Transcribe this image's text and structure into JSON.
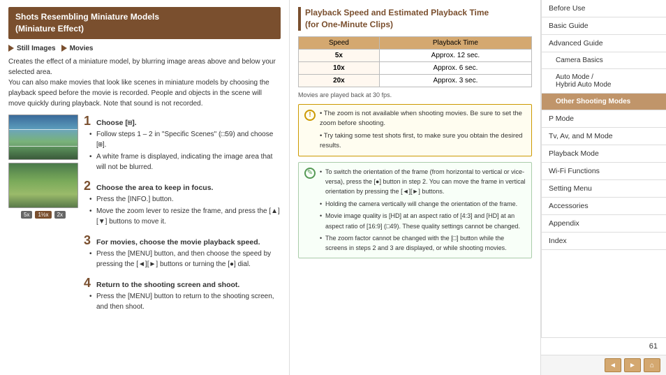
{
  "left": {
    "title": "Shots Resembling Miniature Models\n(Miniature Effect)",
    "media_labels": [
      "Still Images",
      "Movies"
    ],
    "description": [
      "Creates the effect of a miniature model, by blurring image areas above and below your selected area.",
      "You can also make movies that look like scenes in miniature models by choosing the playback speed before the movie is recorded. People and objects in the scene will move quickly during playback. Note that sound is not recorded."
    ],
    "steps": [
      {
        "number": "1",
        "title": "Choose [",
        "title_suffix": "].",
        "bullets": [
          "Follow steps 1 – 2 in \"Specific Scenes\" (□59) and choose [",
          "A white frame is displayed, indicating the image area that will not be blurred."
        ]
      },
      {
        "number": "2",
        "title": "Choose the area to keep in focus.",
        "bullets": [
          "Press the [INFO.] button.",
          "Move the zoom lever to resize the frame, and press the [▲][▼] buttons to move it."
        ]
      },
      {
        "number": "3",
        "title": "For movies, choose the movie playback speed.",
        "bullets": [
          "Press the [MENU] button, and then choose the speed by pressing the [◄][►] buttons or turning the [●] dial."
        ]
      },
      {
        "number": "4",
        "title": "Return to the shooting screen and shoot.",
        "bullets": [
          "Press the [MENU] button to return to the shooting screen, and then shoot."
        ]
      }
    ],
    "speed_buttons": [
      "5x",
      "1½x",
      "2x"
    ]
  },
  "center": {
    "title": "Playback Speed and Estimated Playback Time\n(for One-Minute Clips)",
    "table": {
      "headers": [
        "Speed",
        "Playback Time"
      ],
      "rows": [
        [
          "5x",
          "Approx. 12 sec."
        ],
        [
          "10x",
          "Approx. 6 sec."
        ],
        [
          "20x",
          "Approx. 3 sec."
        ]
      ]
    },
    "fps_note": "Movies are played back at 30 fps.",
    "warning": {
      "bullets": [
        "The zoom is not available when shooting movies. Be sure to set the zoom before shooting.",
        "Try taking some test shots first, to make sure you obtain the desired results."
      ]
    },
    "note": {
      "bullets": [
        "To switch the orientation of the frame (from horizontal to vertical or vice-versa), press the [●] button in step 2. You can move the frame in vertical orientation by pressing the [◄][►] buttons.",
        "Holding the camera vertically will change the orientation of the frame.",
        "Movie image quality is [HD] at an aspect ratio of [4:3] and [HD] at an aspect ratio of [16:9] (□49). These quality settings cannot be changed.",
        "The zoom factor cannot be changed with the [□] button while the screens in steps 2 and 3 are displayed, or while shooting movies."
      ]
    }
  },
  "right": {
    "nav_items": [
      {
        "label": "Before Use",
        "active": false,
        "sub": false
      },
      {
        "label": "Basic Guide",
        "active": false,
        "sub": false
      },
      {
        "label": "Advanced Guide",
        "active": false,
        "sub": false
      },
      {
        "label": "Camera Basics",
        "active": false,
        "sub": true
      },
      {
        "label": "Auto Mode / Hybrid Auto Mode",
        "active": false,
        "sub": true
      },
      {
        "label": "Other Shooting Modes",
        "active": true,
        "sub": true
      },
      {
        "label": "P Mode",
        "active": false,
        "sub": false
      },
      {
        "label": "Tv, Av, and M Mode",
        "active": false,
        "sub": false
      },
      {
        "label": "Playback Mode",
        "active": false,
        "sub": false
      },
      {
        "label": "Wi-Fi Functions",
        "active": false,
        "sub": false
      },
      {
        "label": "Setting Menu",
        "active": false,
        "sub": false
      },
      {
        "label": "Accessories",
        "active": false,
        "sub": false
      },
      {
        "label": "Appendix",
        "active": false,
        "sub": false
      },
      {
        "label": "Index",
        "active": false,
        "sub": false
      }
    ],
    "page_number": "61",
    "prev_label": "◄",
    "next_label": "►",
    "home_label": "⌂"
  }
}
